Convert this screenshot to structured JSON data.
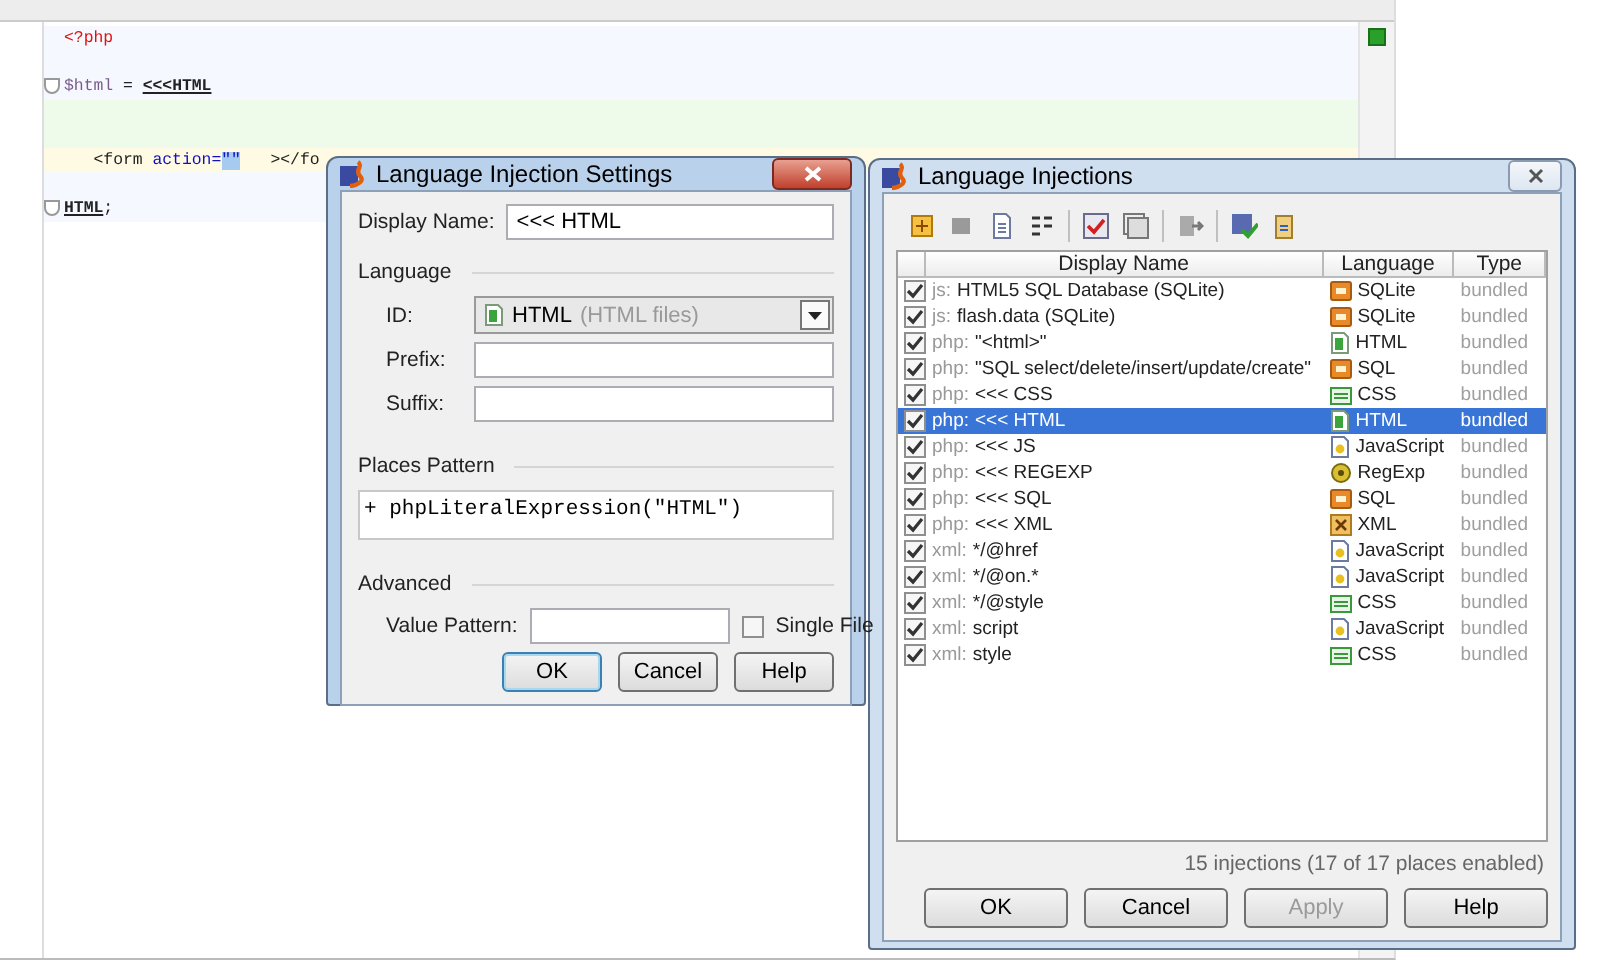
{
  "editor": {
    "lines": [
      {
        "current": false,
        "fold": false,
        "tokens": [
          {
            "kind": "tag",
            "text": "<?php"
          }
        ]
      },
      {
        "current": false,
        "fold": false
      },
      {
        "current": false,
        "fold": true,
        "tokens": [
          {
            "kind": "var",
            "text": "$html"
          },
          {
            "kind": "plain",
            "text": " = "
          },
          {
            "kind": "heredoc",
            "text": "<<<HTML"
          }
        ]
      },
      {
        "current": false,
        "fold": false
      },
      {
        "current": false,
        "fold": false
      },
      {
        "current": true,
        "fold": false,
        "tokens": [
          {
            "kind": "plain",
            "text": "   <form "
          },
          {
            "kind": "attr",
            "text": "action="
          },
          {
            "kind": "selected",
            "text": "\"\""
          },
          {
            "kind": "plain",
            "text": "   ></fo"
          }
        ]
      },
      {
        "current": false,
        "fold": false
      },
      {
        "current": false,
        "fold": true,
        "tokens": [
          {
            "kind": "heredoc",
            "text": "HTML"
          },
          {
            "kind": "plain",
            "text": ";"
          }
        ]
      }
    ]
  },
  "settings_dialog": {
    "title": "Language Injection Settings",
    "display_name_label": "Display Name:",
    "display_name": "<<< HTML",
    "language_header": "Language",
    "id_label": "ID:",
    "id_value": "HTML",
    "id_hint": "(HTML files)",
    "prefix_label": "Prefix:",
    "suffix_label": "Suffix:",
    "places_header": "Places Pattern",
    "places_pattern": "+ phpLiteralExpression(\"HTML\")",
    "advanced_header": "Advanced",
    "value_pattern_label": "Value Pattern:",
    "single_file": {
      "label": "Single File",
      "checked": false
    },
    "buttons": [
      {
        "label": "OK",
        "default": true,
        "disabled": false
      },
      {
        "label": "Cancel",
        "default": false,
        "disabled": false
      },
      {
        "label": "Help",
        "default": false,
        "disabled": false
      }
    ]
  },
  "injections_dialog": {
    "title": "Language Injections",
    "columns": [
      "Display Name",
      "Language",
      "Type"
    ],
    "rows": [
      {
        "checked": true,
        "selected": false,
        "prefix": "js:",
        "name": "HTML5 SQL Database (SQLite)",
        "kind": "db",
        "language": "SQLite",
        "type": "bundled"
      },
      {
        "checked": true,
        "selected": false,
        "prefix": "js:",
        "name": "flash.data (SQLite)",
        "kind": "db",
        "language": "SQLite",
        "type": "bundled"
      },
      {
        "checked": true,
        "selected": false,
        "prefix": "php:",
        "name": "\"<html>\"",
        "kind": "html",
        "language": "HTML",
        "type": "bundled"
      },
      {
        "checked": true,
        "selected": false,
        "prefix": "php:",
        "name": "\"SQL select/delete/insert/update/create\"",
        "kind": "db",
        "language": "SQL",
        "type": "bundled"
      },
      {
        "checked": true,
        "selected": false,
        "prefix": "php:",
        "name": "<<< CSS",
        "kind": "css",
        "language": "CSS",
        "type": "bundled"
      },
      {
        "checked": true,
        "selected": true,
        "prefix": "php:",
        "name": "<<< HTML",
        "kind": "html",
        "language": "HTML",
        "type": "bundled"
      },
      {
        "checked": true,
        "selected": false,
        "prefix": "php:",
        "name": "<<< JS",
        "kind": "js",
        "language": "JavaScript",
        "type": "bundled"
      },
      {
        "checked": true,
        "selected": false,
        "prefix": "php:",
        "name": "<<< REGEXP",
        "kind": "regexp",
        "language": "RegExp",
        "type": "bundled"
      },
      {
        "checked": true,
        "selected": false,
        "prefix": "php:",
        "name": "<<< SQL",
        "kind": "db",
        "language": "SQL",
        "type": "bundled"
      },
      {
        "checked": true,
        "selected": false,
        "prefix": "php:",
        "name": "<<< XML",
        "kind": "xml",
        "language": "XML",
        "type": "bundled"
      },
      {
        "checked": true,
        "selected": false,
        "prefix": "xml:",
        "name": "*/@href",
        "kind": "js",
        "language": "JavaScript",
        "type": "bundled"
      },
      {
        "checked": true,
        "selected": false,
        "prefix": "xml:",
        "name": "*/@on.*",
        "kind": "js",
        "language": "JavaScript",
        "type": "bundled"
      },
      {
        "checked": true,
        "selected": false,
        "prefix": "xml:",
        "name": "*/@style",
        "kind": "css",
        "language": "CSS",
        "type": "bundled"
      },
      {
        "checked": true,
        "selected": false,
        "prefix": "xml:",
        "name": "script",
        "kind": "js",
        "language": "JavaScript",
        "type": "bundled"
      },
      {
        "checked": true,
        "selected": false,
        "prefix": "xml:",
        "name": "style",
        "kind": "css",
        "language": "CSS",
        "type": "bundled"
      }
    ],
    "status": "15 injections (17 of 17 places enabled)",
    "buttons": [
      {
        "label": "OK",
        "default": false,
        "disabled": false
      },
      {
        "label": "Cancel",
        "default": false,
        "disabled": false
      },
      {
        "label": "Apply",
        "default": false,
        "disabled": true
      },
      {
        "label": "Help",
        "default": false,
        "disabled": false
      }
    ]
  }
}
